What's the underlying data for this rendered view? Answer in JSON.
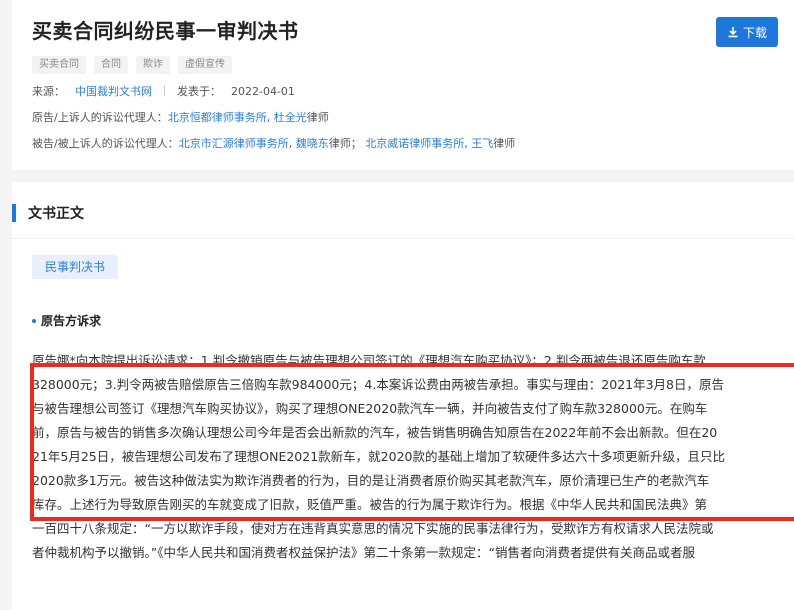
{
  "header": {
    "title": "买卖合同纠纷民事一审判决书",
    "download_label": "下载",
    "tags": [
      "买卖合同",
      "合同",
      "欺诈",
      "虚假宣传"
    ],
    "source_label": "来源：",
    "source_value": "中国裁判文书网",
    "publish_label": "发表于：",
    "publish_date": "2022-04-01",
    "plaintiff_agent_label": "原告/上诉人的诉讼代理人：",
    "plaintiff_firm": "北京恒都律师事务所",
    "plaintiff_lawyer": "杜全光",
    "lawyer_suffix": "律师",
    "defendant_agent_label": "被告/被上诉人的诉讼代理人：",
    "defendant_firm_1": "北京市汇源律师事务所",
    "defendant_lawyer_1": "魏晓东",
    "defendant_suffix_1": "律师；",
    "defendant_firm_2": "北京威诺律师事务所",
    "defendant_lawyer_2": "王飞",
    "defendant_suffix_2": "律师"
  },
  "body": {
    "section_title": "文书正文",
    "doc_type": "民事判决书",
    "sub_heading": "原告方诉求",
    "paragraph_lines": [
      "原告娜*向本院提出诉讼请求：1.判令撤销原告与被告理想公司签订的《理想汽车购买协议》；2.判令两被告退还原告购车款",
      "328000元；3.判令两被告赔偿原告三倍购车款984000元；4.本案诉讼费由两被告承担。事实与理由：2021年3月8日，原告",
      "与被告理想公司签订《理想汽车购买协议》，购买了理想ONE2020款汽车一辆，并向被告支付了购车款328000元。在购车",
      "前，原告与被告的销售多次确认理想公司今年是否会出新款的汽车，被告销售明确告知原告在2022年前不会出新款。但在20",
      "21年5月25日，被告理想公司发布了理想ONE2021款新车，就2020款的基础上增加了软硬件多达六十多项更新升级，且只比",
      "2020款多1万元。被告这种做法实为欺诈消费者的行为，目的是让消费者原价购买其老款汽车，原价清理已生产的老款汽车",
      "库存。上述行为导致原告刚买的车就变成了旧款，贬值严重。被告的行为属于欺诈行为。根据《中华人民共和国民法典》第",
      "一百四十八条规定：“一方以欺诈手段，使对方在违背真实意思的情况下实施的民事法律行为，受欺诈方有权请求人民法院或",
      "者仲裁机构予以撤销。”《中华人民共和国消费者权益保护法》第二十条第一款规定：“销售者向消费者提供有关商品或者服"
    ]
  },
  "colors": {
    "accent": "#1e78dc",
    "link": "#2f7fd6",
    "highlight": "#ee2a1b"
  }
}
